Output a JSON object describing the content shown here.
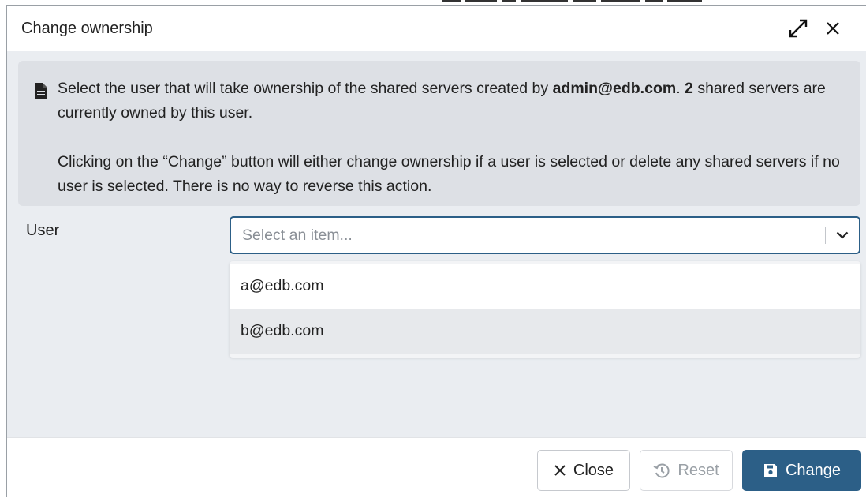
{
  "dialog": {
    "title": "Change ownership"
  },
  "notice": {
    "line1_prefix": "Select the user that will take ownership of the shared servers created by ",
    "owner_email": "admin@edb.com",
    "line1_mid": ". ",
    "server_count": "2",
    "line1_suffix": " shared servers are currently owned by this user.",
    "paragraph2": "Clicking on the “Change” button will either change ownership if a user is selected or delete any shared servers if no user is selected. There is no way to reverse this action."
  },
  "form": {
    "user_label": "User",
    "select_placeholder": "Select an item...",
    "options": [
      "a@edb.com",
      "b@edb.com"
    ]
  },
  "footer": {
    "close_label": "Close",
    "reset_label": "Reset",
    "change_label": "Change"
  },
  "icons": {
    "title": [
      "maximize-icon",
      "close-icon"
    ],
    "notice": "document-icon",
    "select": "chevron-down-icon",
    "buttons": [
      "close-icon",
      "reset-icon",
      "save-icon"
    ]
  },
  "colors": {
    "accent": "#2c5f87",
    "panel_bg": "#eaedf1",
    "notice_bg": "#dde0e5"
  }
}
